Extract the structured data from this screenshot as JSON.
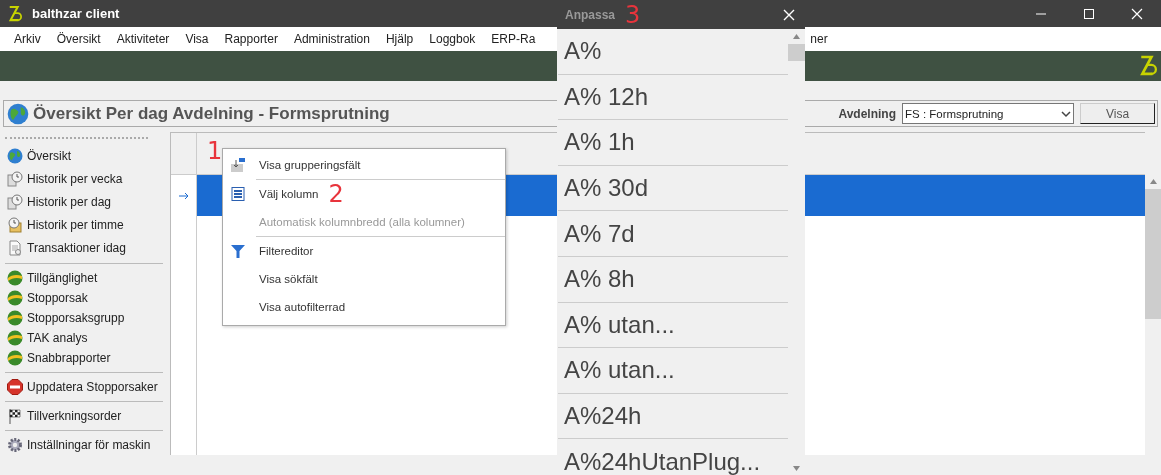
{
  "window": {
    "title": "balthzar client"
  },
  "menu": {
    "items": [
      "Arkiv",
      "Översikt",
      "Aktiviteter",
      "Visa",
      "Rapporter",
      "Administration",
      "Hjälp",
      "Loggbok",
      "ERP-Ra"
    ],
    "trailing": "ner"
  },
  "header": {
    "title": "Översikt Per dag Avdelning - Formsprutning",
    "filter_label": "Avdelning",
    "filter_value": "FS : Formsprutning",
    "button": "Visa"
  },
  "sidebar": {
    "groups": [
      [
        {
          "label": "Översikt",
          "kind": "globe"
        },
        {
          "label": "Historik per vecka",
          "kind": "history"
        },
        {
          "label": "Historik per dag",
          "kind": "history"
        },
        {
          "label": "Historik per timme",
          "kind": "hour"
        },
        {
          "label": "Transaktioner idag",
          "kind": "document"
        }
      ],
      [
        {
          "label": "Tillgänglighet",
          "kind": "report"
        },
        {
          "label": "Stopporsak",
          "kind": "report"
        },
        {
          "label": "Stopporsaksgrupp",
          "kind": "report"
        },
        {
          "label": "TAK analys",
          "kind": "report"
        },
        {
          "label": "Snabbrapporter",
          "kind": "report"
        }
      ],
      [
        {
          "label": "Uppdatera Stopporsaker",
          "kind": "stop"
        }
      ],
      [
        {
          "label": "Tillverkningsorder",
          "kind": "flag"
        }
      ],
      [
        {
          "label": "Inställningar för maskin",
          "kind": "gear"
        }
      ]
    ]
  },
  "grid": {
    "rows": [
      {
        "selected": true
      }
    ]
  },
  "context_menu": {
    "groups": [
      [
        {
          "label": "Visa grupperingsfält",
          "kind": "grouping",
          "disabled": false
        }
      ],
      [
        {
          "label": "Välj kolumn",
          "kind": "columns",
          "disabled": false
        },
        {
          "label": "Automatisk kolumnbredd (alla kolumner)",
          "kind": "plain",
          "disabled": true
        }
      ],
      [
        {
          "label": "Filtereditor",
          "kind": "filter",
          "disabled": false
        },
        {
          "label": "Visa sökfält",
          "kind": "plain",
          "disabled": false
        },
        {
          "label": "Visa autofilterrad",
          "kind": "plain",
          "disabled": false
        }
      ]
    ]
  },
  "annotations": [
    "1",
    "2",
    "3"
  ],
  "customize": {
    "title": "Anpassa",
    "items": [
      "A%",
      "A% 12h",
      "A% 1h",
      "A% 30d",
      "A% 7d",
      "A% 8h",
      "A% utan...",
      "A% utan...",
      "A%24h",
      "A%24hUtanPlug..."
    ]
  }
}
